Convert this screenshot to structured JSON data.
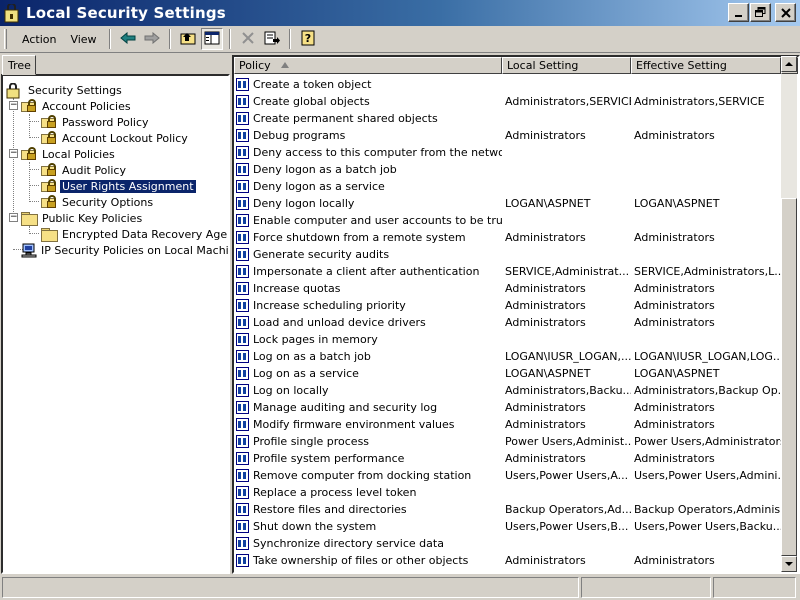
{
  "window": {
    "title": "Local Security Settings"
  },
  "menu": {
    "action": "Action",
    "view": "View"
  },
  "toolbar_icons": [
    "back-arrow-icon",
    "forward-arrow-icon",
    "up-folder-icon",
    "show-hide-tree-icon",
    "delete-icon",
    "export-list-icon",
    "help-icon"
  ],
  "tree": {
    "tab_label": "Tree",
    "root": "Security Settings",
    "account_policies": "Account Policies",
    "password_policy": "Password Policy",
    "account_lockout_policy": "Account Lockout Policy",
    "local_policies": "Local Policies",
    "audit_policy": "Audit Policy",
    "user_rights_assignment": "User Rights Assignment",
    "security_options": "Security Options",
    "public_key_policies": "Public Key Policies",
    "encrypted_data_recovery_agents": "Encrypted Data Recovery Agents",
    "ip_security_policies": "IP Security Policies on Local Machine"
  },
  "columns": {
    "policy": "Policy",
    "local_setting": "Local Setting",
    "effective_setting": "Effective Setting"
  },
  "rows": [
    {
      "policy": "Create a token object",
      "local": "",
      "effective": ""
    },
    {
      "policy": "Create global objects",
      "local": "Administrators,SERVICE",
      "effective": "Administrators,SERVICE"
    },
    {
      "policy": "Create permanent shared objects",
      "local": "",
      "effective": ""
    },
    {
      "policy": "Debug programs",
      "local": "Administrators",
      "effective": "Administrators"
    },
    {
      "policy": "Deny access to this computer from the network",
      "local": "",
      "effective": ""
    },
    {
      "policy": "Deny logon as a batch job",
      "local": "",
      "effective": ""
    },
    {
      "policy": "Deny logon as a service",
      "local": "",
      "effective": ""
    },
    {
      "policy": "Deny logon locally",
      "local": "LOGAN\\ASPNET",
      "effective": "LOGAN\\ASPNET"
    },
    {
      "policy": "Enable computer and user accounts to be truste...",
      "local": "",
      "effective": ""
    },
    {
      "policy": "Force shutdown from a remote system",
      "local": "Administrators",
      "effective": "Administrators"
    },
    {
      "policy": "Generate security audits",
      "local": "",
      "effective": ""
    },
    {
      "policy": "Impersonate a client after authentication",
      "local": "SERVICE,Administrat...",
      "effective": "SERVICE,Administrators,L..."
    },
    {
      "policy": "Increase quotas",
      "local": "Administrators",
      "effective": "Administrators"
    },
    {
      "policy": "Increase scheduling priority",
      "local": "Administrators",
      "effective": "Administrators"
    },
    {
      "policy": "Load and unload device drivers",
      "local": "Administrators",
      "effective": "Administrators"
    },
    {
      "policy": "Lock pages in memory",
      "local": "",
      "effective": ""
    },
    {
      "policy": "Log on as a batch job",
      "local": "LOGAN\\IUSR_LOGAN,...",
      "effective": "LOGAN\\IUSR_LOGAN,LOG..."
    },
    {
      "policy": "Log on as a service",
      "local": "LOGAN\\ASPNET",
      "effective": "LOGAN\\ASPNET"
    },
    {
      "policy": "Log on locally",
      "local": "Administrators,Backu...",
      "effective": "Administrators,Backup Op..."
    },
    {
      "policy": "Manage auditing and security log",
      "local": "Administrators",
      "effective": "Administrators"
    },
    {
      "policy": "Modify firmware environment values",
      "local": "Administrators",
      "effective": "Administrators"
    },
    {
      "policy": "Profile single process",
      "local": "Power Users,Administ...",
      "effective": "Power Users,Administrators"
    },
    {
      "policy": "Profile system performance",
      "local": "Administrators",
      "effective": "Administrators"
    },
    {
      "policy": "Remove computer from docking station",
      "local": "Users,Power Users,A...",
      "effective": "Users,Power Users,Admini..."
    },
    {
      "policy": "Replace a process level token",
      "local": "",
      "effective": ""
    },
    {
      "policy": "Restore files and directories",
      "local": "Backup Operators,Ad...",
      "effective": "Backup Operators,Adminis..."
    },
    {
      "policy": "Shut down the system",
      "local": "Users,Power Users,B...",
      "effective": "Users,Power Users,Backu..."
    },
    {
      "policy": "Synchronize directory service data",
      "local": "",
      "effective": ""
    },
    {
      "policy": "Take ownership of files or other objects",
      "local": "Administrators",
      "effective": "Administrators"
    }
  ]
}
